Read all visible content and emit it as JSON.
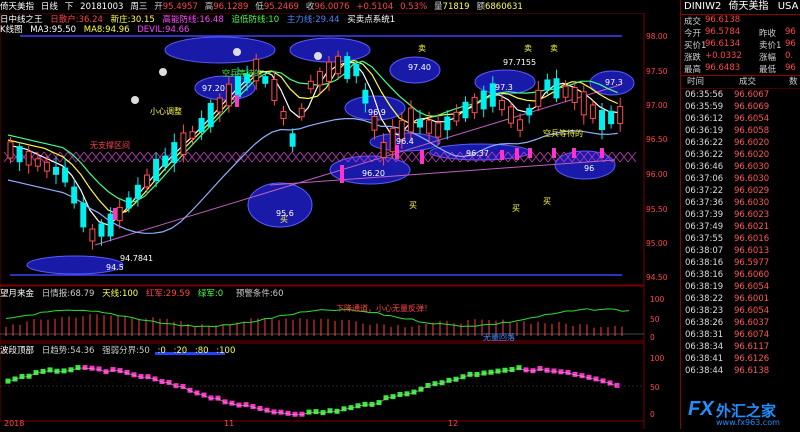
{
  "header": {
    "symbol": "倚天美指",
    "period": "日线",
    "nav": "下",
    "date": "20181003",
    "weekday": "周三",
    "open_label": "开",
    "open": "95.4957",
    "high_label": "高",
    "high": "96.1289",
    "low_label": "低",
    "low": "95.2469",
    "close_label": "收",
    "close": "96.0076",
    "change": "+0.5104",
    "change_pct": "0.53%",
    "vol_label": "量",
    "vol": "71819",
    "amount_label": "额",
    "amount": "6860631"
  },
  "indicator_line": {
    "name": "日中线之王",
    "items": [
      "日散户:36.24",
      "新庄:30.15",
      "高能防线:16.48",
      "追低防线:10",
      "主力线:29.44"
    ],
    "extra": "买卖点系统1",
    "ma_label": "MA3:95.50",
    "ma_extra": "MA8:94.96",
    "devil": "DEVIL:94.66"
  },
  "main_label": "K线图",
  "mid_panel": {
    "title": "望月来金",
    "items": [
      "日情报:68.79",
      "天线:100",
      "红军:29.59",
      "绿军:0",
      "",
      "预警条件:60"
    ]
  },
  "low_panel": {
    "title": "波段顶部",
    "items": [
      "日趋势:54.36",
      "强弱分界:50",
      ":0",
      ":20",
      ":80",
      ":100"
    ]
  },
  "bottom_axis": [
    "2018",
    "11",
    "12"
  ],
  "annotations": {
    "wait_buy": "空兵等待的",
    "careful": "小心调整",
    "no_support": "无支撑区间",
    "buy": "买",
    "sell": "卖",
    "down_channel": "下降通道，小心无量反弹！",
    "mid_down": "无量回落",
    "lowest": "94.7841",
    "top_val": "97.7155"
  },
  "price_axis": [
    "98.00",
    "97.50",
    "97.00",
    "96.50",
    "96.00",
    "95.50",
    "95.00",
    "94.50"
  ],
  "mid_axis": [
    "100",
    "50",
    "0"
  ],
  "low_axis": [
    "100",
    "50",
    "0"
  ],
  "circles": [
    "97.20",
    "97.40",
    "97.3",
    "97.3",
    "96.9",
    "96.4",
    "96.37",
    "96.20",
    "95.6",
    "94.5",
    "96"
  ],
  "quote": {
    "title_code": "DINIW2",
    "title_name": "倚天美指",
    "title_ccy": "USA",
    "rows": [
      {
        "l": "成交",
        "v": "96.6138",
        "l2": "",
        "v2": ""
      },
      {
        "l": "今开",
        "v": "96.5784",
        "l2": "昨收",
        "v2": "96"
      },
      {
        "l": "买价1",
        "v": "96.6134",
        "l2": "卖价1",
        "v2": "96"
      },
      {
        "l": "涨跌",
        "v": "+0.0332",
        "l2": "涨幅",
        "v2": "0."
      },
      {
        "l": "最高",
        "v": "96.6483",
        "l2": "最低",
        "v2": "96"
      }
    ],
    "tick_headers": [
      "时间",
      "成交",
      "数"
    ],
    "ticks": [
      {
        "t": "06:35:56",
        "p": "96.6067"
      },
      {
        "t": "06:35:59",
        "p": "96.6069"
      },
      {
        "t": "06:36:12",
        "p": "96.6054"
      },
      {
        "t": "06:36:19",
        "p": "96.6058"
      },
      {
        "t": "06:36:22",
        "p": "96.6020"
      },
      {
        "t": "06:36:22",
        "p": "96.6020"
      },
      {
        "t": "06:36:46",
        "p": "96.6030"
      },
      {
        "t": "06:37:06",
        "p": "96.6030"
      },
      {
        "t": "06:37:22",
        "p": "96.6029"
      },
      {
        "t": "06:37:36",
        "p": "96.6030"
      },
      {
        "t": "06:37:39",
        "p": "96.6023"
      },
      {
        "t": "06:37:49",
        "p": "96.6021"
      },
      {
        "t": "06:37:55",
        "p": "96.6016"
      },
      {
        "t": "06:38:07",
        "p": "96.6013"
      },
      {
        "t": "06:38:16",
        "p": "96.5977"
      },
      {
        "t": "06:38:16",
        "p": "96.6060"
      },
      {
        "t": "06:38:19",
        "p": "96.6054"
      },
      {
        "t": "06:38:22",
        "p": "96.6001"
      },
      {
        "t": "06:38:23",
        "p": "96.6054"
      },
      {
        "t": "06:38:26",
        "p": "96.6037"
      },
      {
        "t": "06:38:31",
        "p": "96.6074"
      },
      {
        "t": "06:38:34",
        "p": "96.6117"
      },
      {
        "t": "06:38:41",
        "p": "96.6126"
      },
      {
        "t": "06:38:44",
        "p": "96.6138"
      }
    ]
  },
  "watermark": {
    "brand": "FX",
    "text": "外汇之家",
    "url": "www.fx963.com"
  }
}
